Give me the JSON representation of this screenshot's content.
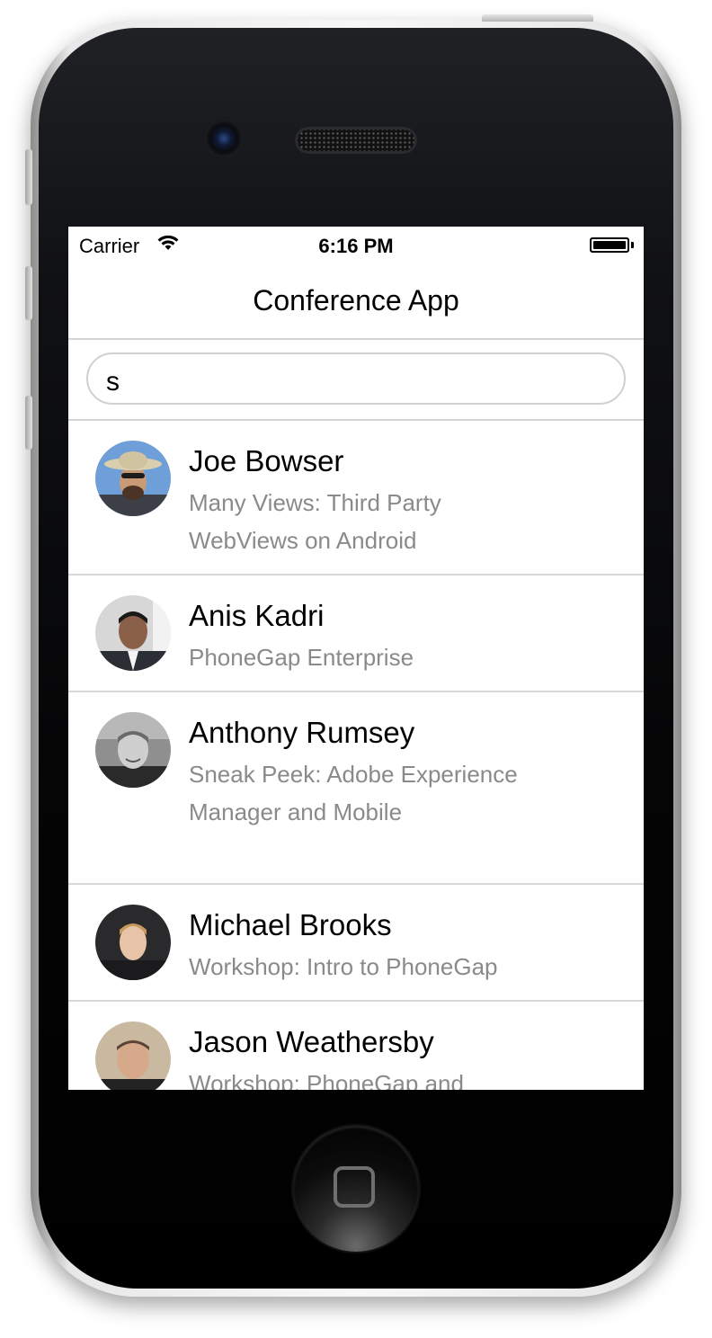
{
  "status_bar": {
    "carrier": "Carrier",
    "time": "6:16 PM"
  },
  "nav": {
    "title": "Conference App"
  },
  "search": {
    "value": "s"
  },
  "speakers": [
    {
      "name": "Joe Bowser",
      "talk": "Many Views: Third Party WebViews on Android"
    },
    {
      "name": "Anis Kadri",
      "talk": "PhoneGap Enterprise"
    },
    {
      "name": "Anthony Rumsey",
      "talk": "Sneak Peek: Adobe Experience Manager and Mobile"
    },
    {
      "name": "Michael Brooks",
      "talk": "Workshop: Intro to PhoneGap"
    },
    {
      "name": "Jason Weathersby",
      "talk": "Workshop: PhoneGap and"
    }
  ],
  "icons": {
    "wifi": "wifi-icon",
    "battery": "battery-icon",
    "camera": "camera-icon",
    "speaker": "speaker-grille-icon",
    "home": "home-button-icon"
  }
}
